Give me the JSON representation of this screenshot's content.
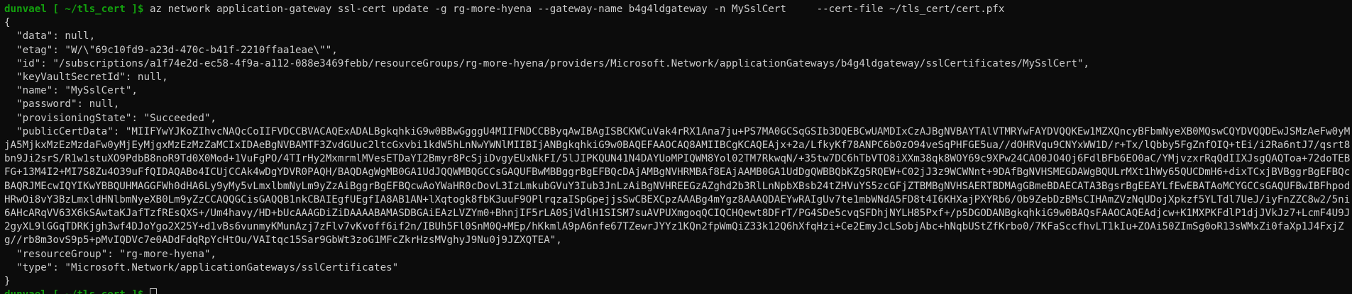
{
  "terminal": {
    "prompt": {
      "user": "dunvael",
      "path": "[ ~/tls_cert ]$"
    },
    "command": "az network application-gateway ssl-cert update -g rg-more-hyena --gateway-name b4g4ldgateway -n MySslCert     --cert-file ~/tls_cert/cert.pfx",
    "output": {
      "open_brace": "{",
      "data": "  \"data\": null,",
      "etag": "  \"etag\": \"W/\\\"69c10fd9-a23d-470c-b41f-2210ffaa1eae\\\"\",",
      "id": "  \"id\": \"/subscriptions/a1f74e2d-ec58-4f9a-a112-088e3469febb/resourceGroups/rg-more-hyena/providers/Microsoft.Network/applicationGateways/b4g4ldgateway/sslCertificates/MySslCert\",",
      "keyVaultSecretId": "  \"keyVaultSecretId\": null,",
      "name": "  \"name\": \"MySslCert\",",
      "password": "  \"password\": null,",
      "provisioningState": "  \"provisioningState\": \"Succeeded\",",
      "publicCertData": "  \"publicCertData\": \"MIIFYwYJKoZIhvcNAQcCoIIFVDCCBVACAQExADALBgkqhkiG9w0BBwGgggU4MIIFNDCCBByqAwIBAgISBCKWCuVak4rRX1Ana7ju+PS7MA0GCSqGSIb3DQEBCwUAMDIxCzAJBgNVBAYTAlVTMRYwFAYDVQQKEw1MZXQncyBFbmNyeXB0MQswCQYDVQQDEwJSMzAeFw0yMjA5MjkxMzEzMzdaFw0yMjEyMjgxMzEzMzZaMCIxIDAeBgNVBAMTF3ZvdGUuc2ltcGxvbi1kdW5hLnNwYWNlMIIBIjANBgkqhkiG9w0BAQEFAAOCAQ8AMIIBCgKCAQEAjx+2a/LfkyKf78ANPC6b0zO94veSqPHFGE5ua//dOHRVqu9CNYxWW1D/r+Tx/lQbby5FgZnfOIQ+tEi/i2Ra6ntJ7/qsrt8bn9Ji2srS/R1w1stuXO9PdbB8noR9Td0X0Mod+1VuFgPO/4TIrHy2MxmrmlMVesETDaYI2Bmyr8PcSjiDvgyEUxNkFI/5lJIPKQUN41N4DAYUoMPIQWM8Yol02TM7RkwqN/+35tw7DC6hTbVTO8iXXm38qk8WOY69c9XPw24CAO0JO4Oj6FdlBFb6EO0aC/YMjvzxrRqQdIIXJsgQAQToa+72doTEBFG+13M4I2+MI7S8Zu4O39uFfQIDAQABo4ICUjCCAk4wDgYDVR0PAQH/BAQDAgWgMB0GA1UdJQQWMBQGCCsGAQUFBwMBBggrBgEFBQcDAjAMBgNVHRMBAf8EAjAAMB0GA1UdDgQWBBQbKZg5RQEW+C02jJ3z9WCWNnt+9DAfBgNVHSMEGDAWgBQULrMXt1hWy65QUCDmH6+dixTCxjBVBggrBgEFBQcBAQRJMEcwIQYIKwYBBQUHMAGGFWh0dHA6Ly9yMy5vLmxlbmNyLm9yZzAiBggrBgEFBQcwAoYWaHR0cDovL3IzLmkubGVuY3Iub3JnLzAiBgNVHREEGzAZghd2b3RlLnNpbXBsb24tZHVuYS5zcGFjZTBMBgNVHSAERTBDMAgGBmeBDAECATA3BgsrBgEEAYLfEwEBATAoMCYGCCsGAQUFBwIBFhpodHRwOi8vY3BzLmxldHNlbmNyeXB0Lm9yZzCCAQQGCisGAQQB1nkCBAIEgfUEgfIA8AB1AN+lXqtogk8fbK3uuF9OPlrqzaISpGpejjsSwCBEXCpzAAABg4mYgz8AAAQDAEYwRAIgUv7te1mbWNdA5FD8t4I6KHXajPXYRb6/Ob9ZebDzBMsCIHAmZVzNqUDojXpkzf5YLTdl7UeJ/iyFnZZC8w2/5ni6AHcARqVV63X6kSAwtaKJafTzfREsQXS+/Um4havy/HD+bUcAAAGDiZiDAAAABAMASDBGAiEAzLVZYm0+BhnjIF5rLA0SjVdlH1SISM7suAVPUXmgoqQCIQCHQewt8DFrT/PG4SDe5cvqSFDhjNYLH85Pxf+/p5DGODANBgkqhkiG9w0BAQsFAAOCAQEAdjcw+K1MXPKFdlP1djJVkJz7+LcmF4U9J2gyXL9lGGqTDRKjgh3wf4DJoYgo2X25Y+d1vBs6vunmyKMunAzj7zFlv7vKvoff6if2n/IBUh5Fl0SnM0Q+MEp/hKkmlA9pA6nfe67TZewrJYYz1KQn2fpWmQiZ33k12Q6hXfqHzi+Ce2EmyJcLSobjAbc+hNqbUStZfKrbo0/7KFaSccfhvLT1kIu+ZOAi50ZImSg0oR13sWMxZi0faXp1J4FxjZg//rb8m3ovS9p5+pMvIQDVc7e0ADdFdqRpYcHtOu/VAItqc15Sar9GbWt3zoG1MFcZkrHzsMVghyJ9Nu0j9JZXQTEA\",",
      "resourceGroup": "  \"resourceGroup\": \"rg-more-hyena\",",
      "type": "  \"type\": \"Microsoft.Network/applicationGateways/sslCertificates\"",
      "close_brace": "}"
    }
  }
}
